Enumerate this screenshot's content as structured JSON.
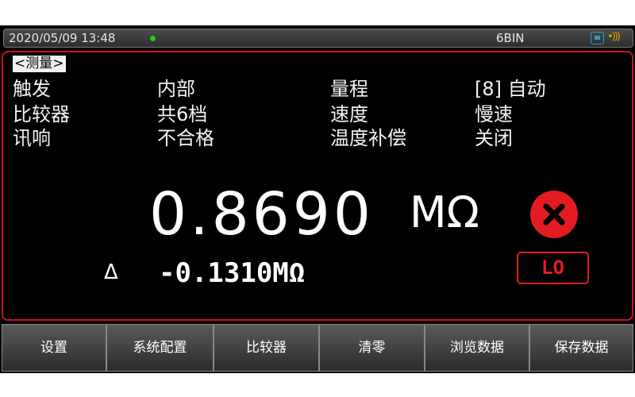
{
  "status": {
    "datetime": "2020/05/09  13:48",
    "bin": "6BIN",
    "dot_color": "#19d219",
    "icons": [
      "usb-icon",
      "signal-icon"
    ]
  },
  "screen": {
    "tag": "<测量>",
    "params": [
      {
        "label": "触发",
        "value": "内部"
      },
      {
        "label": "比较器",
        "value": "共6档"
      },
      {
        "label": "讯响",
        "value": "不合格"
      }
    ],
    "params_right": [
      {
        "label": "量程",
        "value": "[8] 自动"
      },
      {
        "label": "速度",
        "value": "慢速"
      },
      {
        "label": "温度补偿",
        "value": "关闭"
      }
    ],
    "measurement": {
      "value": "0.8690",
      "unit": "MΩ"
    },
    "deviation": {
      "symbol": "Δ",
      "value": "-0.1310MΩ"
    },
    "result": "LO",
    "accent_color": "#e31b23"
  },
  "softkeys": [
    "设置",
    "系统配置",
    "比较器",
    "清零",
    "浏览数据",
    "保存数据"
  ]
}
